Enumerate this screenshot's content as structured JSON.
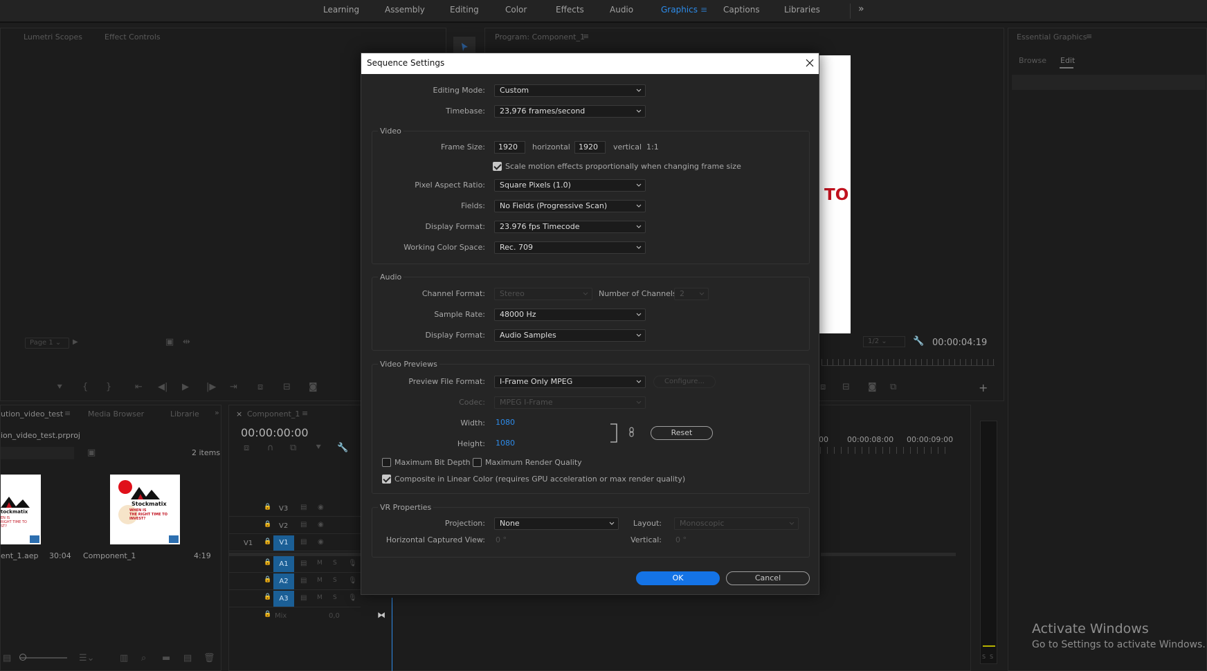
{
  "workspaces": {
    "items": [
      "Learning",
      "Assembly",
      "Editing",
      "Color",
      "Effects",
      "Audio",
      "Graphics",
      "Captions",
      "Libraries"
    ],
    "active": "Graphics",
    "more": "»"
  },
  "source_panel": {
    "tabs": [
      "Lumetri Scopes",
      "Effect Controls"
    ],
    "page_select": "Page 1"
  },
  "program_monitor": {
    "title": "Program: Component_1",
    "overlay_text": "TO",
    "resolution": "1/2",
    "timecode": "00:00:04:19"
  },
  "essential_graphics": {
    "title": "Essential Graphics",
    "tabs": [
      "Browse",
      "Edit"
    ],
    "active_tab": "Edit"
  },
  "project_panel": {
    "tabs": [
      "ution_video_test",
      "Media Browser",
      "Librarie"
    ],
    "project_file": "ion_video_test.prproj",
    "item_count": "2 items",
    "items": [
      {
        "name": "ent_1.aep",
        "duration": "30:04",
        "thumb_brand": "tockmatix",
        "thumb_text": "EN IS\nRIGHT TIME TO\nST?"
      },
      {
        "name": "Component_1",
        "duration": "4:19",
        "thumb_brand": "Stockmatix",
        "thumb_text": "WHEN IS\nTHE RIGHT TIME TO\nINVEST?"
      }
    ]
  },
  "timeline": {
    "tab": "Component_1",
    "timecode": "00:00:00:00",
    "ruler": [
      "00",
      "00:00:08:00",
      "00:00:09:00"
    ],
    "video_tracks": [
      "V3",
      "V2",
      "V1"
    ],
    "source_patch": "V1",
    "audio_tracks": [
      "A1",
      "A2",
      "A3"
    ],
    "mix_label": "Mix",
    "mix_value": "0,0",
    "meter_labels": [
      "S",
      "S"
    ]
  },
  "dialog": {
    "title": "Sequence Settings",
    "editing_mode": {
      "label": "Editing Mode:",
      "value": "Custom"
    },
    "timebase": {
      "label": "Timebase:",
      "value": "23,976  frames/second"
    },
    "video": {
      "title": "Video",
      "frame_size_label": "Frame Size:",
      "frame_width": "1920",
      "horizontal_label": "horizontal",
      "frame_height": "1920",
      "vertical_label": "vertical",
      "ratio": "1:1",
      "scale_motion": {
        "label": "Scale motion effects proportionally when changing frame size",
        "checked": true
      },
      "pixel_aspect": {
        "label": "Pixel Aspect Ratio:",
        "value": "Square Pixels (1.0)"
      },
      "fields": {
        "label": "Fields:",
        "value": "No Fields (Progressive Scan)"
      },
      "display_format": {
        "label": "Display Format:",
        "value": "23.976 fps Timecode"
      },
      "color_space": {
        "label": "Working Color Space:",
        "value": "Rec. 709"
      }
    },
    "audio": {
      "title": "Audio",
      "channel_format": {
        "label": "Channel Format:",
        "value": "Stereo"
      },
      "channels": {
        "label": "Number of Channels:",
        "value": "2"
      },
      "sample_rate": {
        "label": "Sample Rate:",
        "value": "48000 Hz"
      },
      "display_format": {
        "label": "Display Format:",
        "value": "Audio Samples"
      }
    },
    "previews": {
      "title": "Video Previews",
      "file_format": {
        "label": "Preview File Format:",
        "value": "I-Frame Only MPEG"
      },
      "configure_label": "Configure...",
      "codec": {
        "label": "Codec:",
        "value": "MPEG I-Frame"
      },
      "width_label": "Width:",
      "width": "1080",
      "height_label": "Height:",
      "height": "1080",
      "reset_label": "Reset",
      "max_bit_depth": {
        "label": "Maximum Bit Depth",
        "checked": false
      },
      "max_render": {
        "label": "Maximum Render Quality",
        "checked": false
      },
      "linear_color": {
        "label": "Composite in Linear Color (requires GPU acceleration or max render quality)",
        "checked": true
      }
    },
    "vr": {
      "title": "VR Properties",
      "projection": {
        "label": "Projection:",
        "value": "None"
      },
      "layout": {
        "label": "Layout:",
        "value": "Monoscopic"
      },
      "h_view": {
        "label": "Horizontal Captured View:",
        "value": "0 °"
      },
      "vertical": {
        "label": "Vertical:",
        "value": "0 °"
      }
    },
    "ok_label": "OK",
    "cancel_label": "Cancel"
  },
  "watermark": {
    "line1": "Activate Windows",
    "line2": "Go to Settings to activate Windows."
  }
}
